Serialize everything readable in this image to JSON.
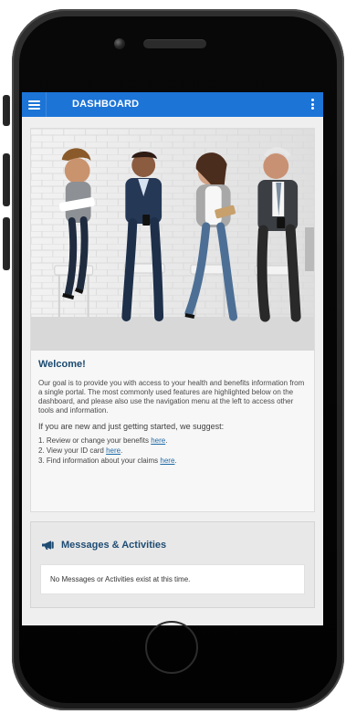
{
  "app": {
    "title": "DASHBOARD"
  },
  "icons": {
    "menu": "hamburger-menu-icon",
    "more": "vertical-kebab-icon",
    "messages": "megaphone-icon"
  },
  "welcome": {
    "title": "Welcome!",
    "intro": "Our goal is to provide you with access to your health and benefits information from a single portal. The most commonly used features are highlighted below on the dashboard, and please also use the navigation menu at the left to access other tools and information.",
    "getting_started": "If you are new and just getting started, we suggest:",
    "steps": [
      {
        "prefix": "1. Review or change your benefits ",
        "link": "here",
        "suffix": "."
      },
      {
        "prefix": "2. View your ID card ",
        "link": "here",
        "suffix": "."
      },
      {
        "prefix": "3. Find information about your claims ",
        "link": "here",
        "suffix": "."
      }
    ]
  },
  "messages": {
    "title": "Messages & Activities",
    "empty_text": "No Messages or Activities exist at this time."
  },
  "colors": {
    "header_blue": "#1c74d7",
    "heading_blue": "#1b4a70",
    "link_blue": "#1f6aa5"
  }
}
